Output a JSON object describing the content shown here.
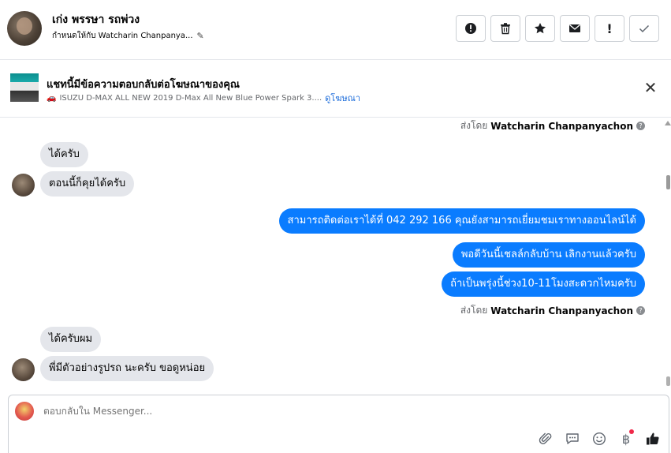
{
  "header": {
    "contact_name": "เก่ง พรรษา รถพ่วง",
    "assigned_to": "กำหนดให้กับ Watcharin Chanpanya...",
    "actions": [
      {
        "icon": "alert-circle-icon",
        "label": "Mark as spam"
      },
      {
        "icon": "trash-icon",
        "label": "Delete"
      },
      {
        "icon": "star-icon",
        "label": "Follow up"
      },
      {
        "icon": "mail-icon",
        "label": "Mark as unread"
      },
      {
        "icon": "exclamation-icon",
        "label": "Priority"
      },
      {
        "icon": "check-icon",
        "label": "Mark as done"
      }
    ]
  },
  "ad_banner": {
    "title": "แชทนี้มีข้อความตอบกลับต่อโฆษณาของคุณ",
    "ad_name": "ISUZU D-MAX ALL NEW 2019 D-Max All New Blue Power Spark 3....",
    "view_ad_link": "ดูโฆษณา"
  },
  "messages": {
    "sent_by_prefix": "ส่งโดย",
    "sender_name": "Watcharin Chanpanyachon",
    "items": [
      {
        "dir": "in",
        "text": "ได้ครับ"
      },
      {
        "dir": "in",
        "text": "ตอนนี้ก็คุยได้ครับ"
      },
      {
        "dir": "out",
        "text": "สามารถติดต่อเราได้ที่ 042 292 166 คุณยังสามารถเยี่ยมชมเราทางออนไลน์ได้"
      },
      {
        "dir": "out",
        "text": "พอดีวันนี้เชลล์กลับบ้าน เลิกงานแล้วครับ"
      },
      {
        "dir": "out",
        "text": "ถ้าเป็นพรุ่งนี้ช่วง10-11โมงสะดวกไหมครับ"
      },
      {
        "dir": "in",
        "text": "ได้ครับผม"
      },
      {
        "dir": "in",
        "text": "พี่มีตัวอย่างรูปรถ นะครับ ขอดูหน่อย"
      }
    ]
  },
  "composer": {
    "placeholder": "ตอบกลับใน Messenger...",
    "tools": [
      "attach-icon",
      "saved-replies-icon",
      "emoji-icon",
      "payment-icon",
      "like-icon"
    ]
  },
  "colors": {
    "outgoing_bubble": "#0a7cff",
    "incoming_bubble": "#e4e6eb",
    "link": "#216fdb"
  }
}
